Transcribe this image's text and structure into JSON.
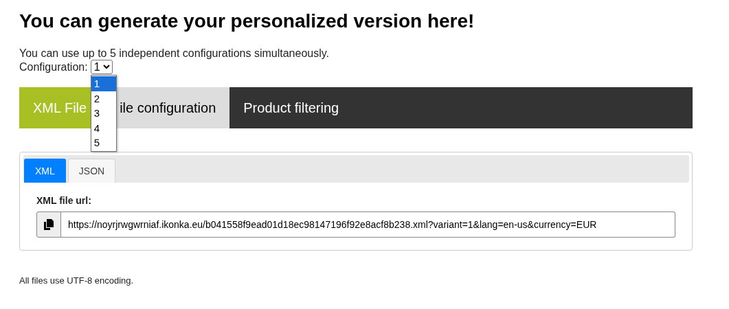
{
  "heading": "You can generate your personalized version here!",
  "intro": "You can use up to 5 independent configurations simultaneously.",
  "configuration": {
    "label": "Configuration:",
    "value": "1",
    "expanded": true,
    "options": [
      {
        "label": "1",
        "selected": true
      },
      {
        "label": "2",
        "selected": false
      },
      {
        "label": "3",
        "selected": false
      },
      {
        "label": "4",
        "selected": false
      },
      {
        "label": "5",
        "selected": false
      }
    ]
  },
  "main_tabs": [
    {
      "label": "XML File",
      "selected": true,
      "hovered": false
    },
    {
      "label": "ile configuration",
      "selected": false,
      "hovered": true
    },
    {
      "label": "Product filtering",
      "selected": false,
      "hovered": false
    }
  ],
  "format_tabs": [
    {
      "label": "XML",
      "selected": true
    },
    {
      "label": "JSON",
      "selected": false
    }
  ],
  "url_field": {
    "label": "XML file url:",
    "value": "https://noyrjrwgwrniaf.ikonka.eu/b041558f9ead01d18ec98147196f92e8acf8b238.xml?variant=1&lang=en-us&currency=EUR"
  },
  "footer": "All files use UTF-8 encoding."
}
